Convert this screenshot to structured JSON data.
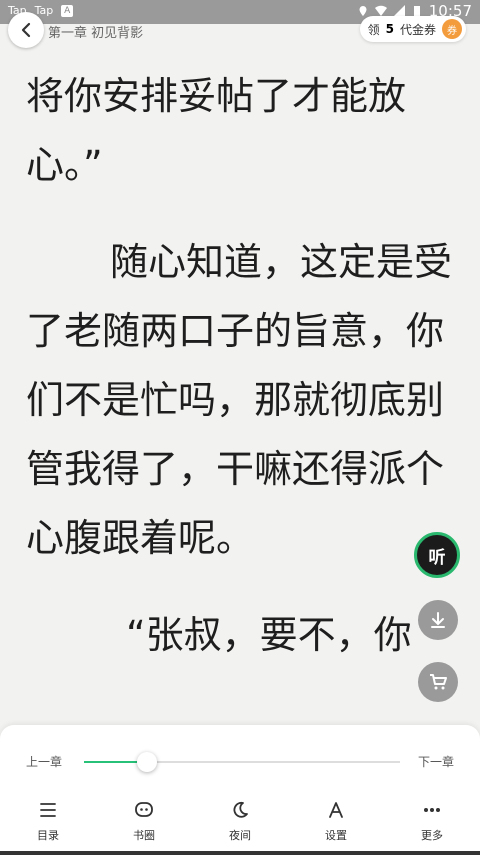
{
  "status": {
    "left1": "Tap",
    "left2": "Tap",
    "badge": "A",
    "time": "10:57"
  },
  "header": {
    "chapter_title": "第一章 初见背影",
    "coupon_prefix": "领",
    "coupon_count": "5",
    "coupon_suffix": "代金券",
    "coupon_badge": "券"
  },
  "content": {
    "paragraphs": [
      "将你安排妥帖了才能放心。”",
      "随心知道，这定是受了老随两口子的旨意，你们不是忙吗，那就彻底别管我得了，干嘛还得派个心腹跟着呢。",
      "“张叔，要不，你"
    ]
  },
  "listen": {
    "label": "听"
  },
  "progress": {
    "prev_label": "上一章",
    "next_label": "下一章",
    "value": 0.2
  },
  "toolbar": {
    "items": [
      {
        "label": "目录",
        "icon": "menu-icon"
      },
      {
        "label": "书圈",
        "icon": "chat-icon"
      },
      {
        "label": "夜间",
        "icon": "moon-icon"
      },
      {
        "label": "设置",
        "icon": "font-icon"
      },
      {
        "label": "更多",
        "icon": "more-icon"
      }
    ]
  },
  "colors": {
    "accent": "#27c178",
    "coupon": "#f39c3d"
  }
}
